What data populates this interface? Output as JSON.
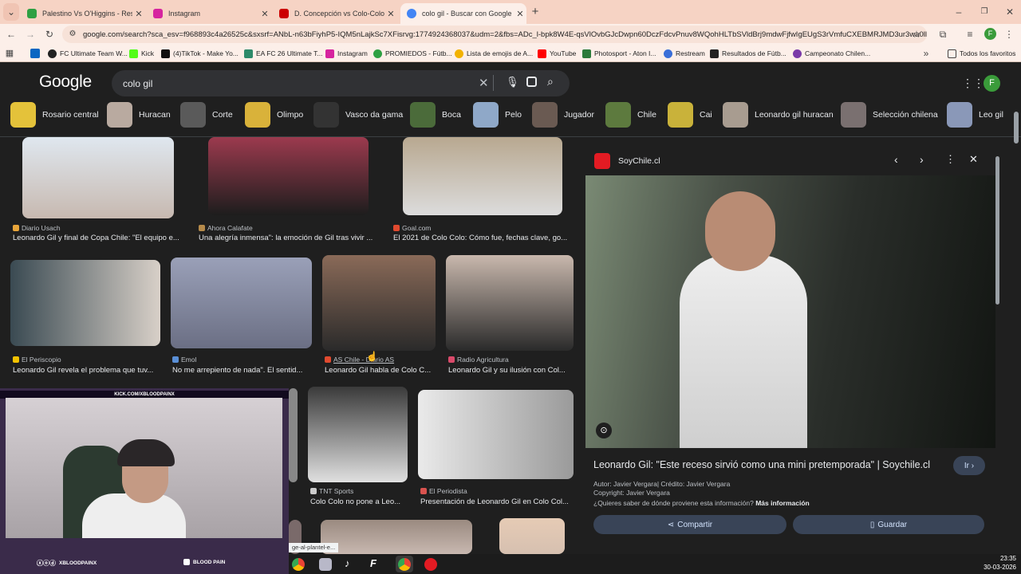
{
  "tabs": [
    {
      "title": "Palestino Vs O'Higgins - Results",
      "color": "#2ea043"
    },
    {
      "title": "Instagram",
      "color": "#d6249f"
    },
    {
      "title": "D. Concepción vs Colo-Colo | C",
      "color": "#cc0000"
    },
    {
      "title": "colo gil - Buscar con Google",
      "color": "#4285f4"
    }
  ],
  "url": "google.com/search?sca_esv=f968893c4a26525c&sxsrf=ANbL-n63bFiyhP5-IQM5nLajkSc7XFisrvg:1774924368037&udm=2&fbs=ADc_l-bpk8W4E-qsVlOvbGJcDwpn60DczFdcvPnuv8WQohHLTbSVldBrj9mdwFjfwIgEUgS3rVmfuCXEBMRJMD3ur3wa0llflE...",
  "profile_initial": "F",
  "bookmarks": [
    "FC Ultimate Team W...",
    "Kick",
    "(4)TikTok - Make Yo...",
    "EA FC 26 Ultimate T...",
    "Instagram",
    "PROMIEDOS - Fútb...",
    "Lista de emojis de A...",
    "YouTube",
    "Photosport - Aton I...",
    "Restream",
    "Resultados de Fútb...",
    "Campeonato Chilen..."
  ],
  "all_bookmarks": "Todos los favoritos",
  "google": {
    "logo": "Google",
    "query": "colo gil",
    "avatar": "F"
  },
  "chips": [
    "Rosario central",
    "Huracan",
    "Corte",
    "Olimpo",
    "Vasco da gama",
    "Boca",
    "Pelo",
    "Jugador",
    "Chile",
    "Cai",
    "Leonardo gil huracan",
    "Selección chilena",
    "Leo gil"
  ],
  "results": [
    {
      "source": "Diario Usach",
      "caption": "Leonardo Gil y final de Copa Chile: \"El equipo e...",
      "c": "#e8a53a"
    },
    {
      "source": "Ahora Calafate",
      "caption": "Una alegría inmensa\": la emoción de Gil tras vivir ...",
      "c": "#b58a4a"
    },
    {
      "source": "Goal.com",
      "caption": "El 2021 de Colo Colo: Cómo fue, fechas clave, go...",
      "c": "#e04a2f"
    },
    {
      "source": "El Periscopio",
      "caption": "Leonardo Gil revela el problema que tuv...",
      "c": "#f2c200"
    },
    {
      "source": "Emol",
      "caption": "No me arrepiento de nada\". El sentid...",
      "c": "#5a8fd6"
    },
    {
      "source": "AS Chile - Diario AS",
      "caption": "Leonardo Gil habla de Colo C...",
      "c": "#e04a2f"
    },
    {
      "source": "Radio Agricultura",
      "caption": "Leonardo Gil y su ilusión con Col...",
      "c": "#d94a6a"
    },
    {
      "source": "TNT Sports",
      "caption": "Colo Colo no pone a Leo...",
      "c": "#cccccc"
    },
    {
      "source": "El Periodista",
      "caption": "Presentación de Leonardo Gil en Colo Col...",
      "c": "#d9534f"
    }
  ],
  "panel": {
    "site": "SoyChile.cl",
    "title": "Leonardo Gil: \"Este receso sirvió como una mini pretemporada\" | Soychile.cl",
    "author": "Autor: Javier Vergara| Crédito: Javier Vergara",
    "copyright": "Copyright: Javier Vergara",
    "question": "¿Quieres saber de dónde proviene esta información?",
    "more": "Más información",
    "go": "Ir",
    "share": "Compartir",
    "save": "Guardar"
  },
  "webcam": {
    "banner": "KICK.COM/XBLOODPAINX",
    "handle": "XBLOODPAINX",
    "name": "BLOOD PAIN"
  },
  "url_tooltip": "ge-al-plantel-e...",
  "clock": {
    "time": "23:35",
    "date": "30-03-2026"
  }
}
